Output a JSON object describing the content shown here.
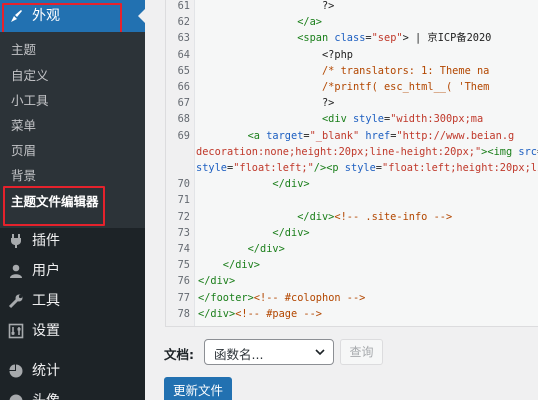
{
  "sidebar": {
    "active": {
      "label": "外观",
      "icon": "paintbrush-icon"
    },
    "submenu": [
      {
        "label": "主题"
      },
      {
        "label": "自定义"
      },
      {
        "label": "小工具"
      },
      {
        "label": "菜单"
      },
      {
        "label": "页眉"
      },
      {
        "label": "背景"
      },
      {
        "label": "主题文件编辑器"
      }
    ],
    "menu": [
      {
        "label": "插件",
        "icon": "plugin-icon"
      },
      {
        "label": "用户",
        "icon": "user-icon"
      },
      {
        "label": "工具",
        "icon": "wrench-icon"
      },
      {
        "label": "设置",
        "icon": "settings-icon"
      },
      {
        "label": "统计",
        "icon": "stats-icon"
      },
      {
        "label": "头像",
        "icon": "avatar-icon"
      }
    ]
  },
  "editor": {
    "lines": [
      {
        "num": "61",
        "parts": [
          {
            "t": "                    ?>",
            "c": "txt"
          }
        ]
      },
      {
        "num": "62",
        "parts": [
          {
            "t": "                </a>",
            "c": "tag"
          }
        ]
      },
      {
        "num": "63",
        "parts": [
          {
            "t": "                <span ",
            "c": "tag"
          },
          {
            "t": "class",
            "c": "attr"
          },
          {
            "t": "=",
            "c": "txt"
          },
          {
            "t": "\"sep\"",
            "c": "str"
          },
          {
            "t": "> | 京ICP备2020",
            "c": "txt"
          }
        ]
      },
      {
        "num": "64",
        "parts": [
          {
            "t": "                    <?php",
            "c": "txt"
          }
        ]
      },
      {
        "num": "65",
        "parts": [
          {
            "t": "                    /* translators: 1: Theme na",
            "c": "cmt"
          }
        ]
      },
      {
        "num": "66",
        "parts": [
          {
            "t": "                    /*printf( esc_html__( 'Them",
            "c": "cmt"
          }
        ]
      },
      {
        "num": "67",
        "parts": [
          {
            "t": "                    ?>",
            "c": "txt"
          }
        ]
      },
      {
        "num": "68",
        "parts": [
          {
            "t": "                    <div ",
            "c": "tag"
          },
          {
            "t": "style",
            "c": "attr"
          },
          {
            "t": "=",
            "c": "txt"
          },
          {
            "t": "\"width:300px;ma",
            "c": "str"
          }
        ]
      },
      {
        "num": "69",
        "parts": [
          {
            "t": "        <a ",
            "c": "tag"
          },
          {
            "t": "target",
            "c": "attr"
          },
          {
            "t": "=",
            "c": "txt"
          },
          {
            "t": "\"_blank\"",
            "c": "str"
          },
          {
            "t": " ",
            "c": "txt"
          },
          {
            "t": "href",
            "c": "attr"
          },
          {
            "t": "=",
            "c": "txt"
          },
          {
            "t": "\"http://www.beian.g",
            "c": "str"
          }
        ]
      },
      {
        "num": "",
        "parts": [
          {
            "t": "decoration:none;height:20px;line-height:20px;\"",
            "c": "str"
          },
          {
            "t": "><img ",
            "c": "tag"
          },
          {
            "t": "src",
            "c": "attr"
          },
          {
            "t": "=",
            "c": "txt"
          },
          {
            "t": "\"ht",
            "c": "str"
          }
        ]
      },
      {
        "num": "",
        "parts": [
          {
            "t": "style",
            "c": "attr"
          },
          {
            "t": "=",
            "c": "txt"
          },
          {
            "t": "\"float:left;\"",
            "c": "str"
          },
          {
            "t": "/><p ",
            "c": "tag"
          },
          {
            "t": "style",
            "c": "attr"
          },
          {
            "t": "=",
            "c": "txt"
          },
          {
            "t": "\"float:left;height:20px;line-",
            "c": "str"
          }
        ]
      },
      {
        "num": "70",
        "parts": [
          {
            "t": "            </div>",
            "c": "tag"
          }
        ]
      },
      {
        "num": "71",
        "parts": [
          {
            "t": "",
            "c": "txt"
          }
        ]
      },
      {
        "num": "72",
        "parts": [
          {
            "t": "                </div>",
            "c": "tag"
          },
          {
            "t": "<!-- .site-info -->",
            "c": "cmt"
          }
        ]
      },
      {
        "num": "73",
        "parts": [
          {
            "t": "            </div>",
            "c": "tag"
          }
        ]
      },
      {
        "num": "74",
        "parts": [
          {
            "t": "        </div>",
            "c": "tag"
          }
        ]
      },
      {
        "num": "75",
        "parts": [
          {
            "t": "    </div>",
            "c": "tag"
          }
        ]
      },
      {
        "num": "76",
        "parts": [
          {
            "t": "</div>",
            "c": "tag"
          }
        ]
      },
      {
        "num": "77",
        "parts": [
          {
            "t": "</footer>",
            "c": "tag"
          },
          {
            "t": "<!-- #colophon -->",
            "c": "cmt"
          }
        ]
      },
      {
        "num": "78",
        "parts": [
          {
            "t": "</div>",
            "c": "tag"
          },
          {
            "t": "<!-- #page -->",
            "c": "cmt"
          }
        ]
      }
    ]
  },
  "controls": {
    "doc_label": "文档:",
    "select_value": "函数名...",
    "lookup_label": "查询",
    "update_label": "更新文件"
  },
  "colors": {
    "accent": "#2271b1",
    "sidebar": "#1d2327",
    "highlight": "#e5222c"
  }
}
